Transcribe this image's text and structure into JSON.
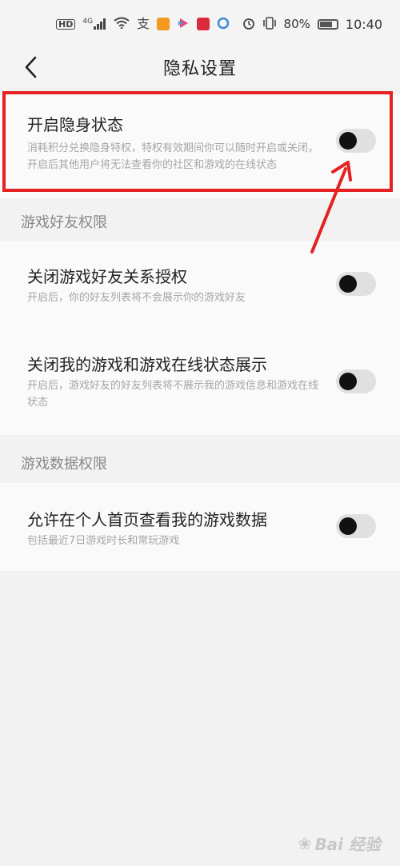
{
  "status_bar": {
    "network_labels": [
      "HD",
      "4G"
    ],
    "left_icon_names": [
      "hd-icon",
      "signal-icon",
      "wifi-icon",
      "alipay-icon",
      "app-icon-orange",
      "app-icon-bilibili",
      "app-icon-red",
      "app-icon-blue"
    ],
    "battery": "80%",
    "time": "10:40"
  },
  "header": {
    "title": "隐私设置"
  },
  "invisible": {
    "title": "开启隐身状态",
    "desc": "消耗积分兑换隐身特权，特权有效期间你可以随时开启或关闭，开启后其他用户将无法查看你的社区和游戏的在线状态",
    "toggle_on": false
  },
  "friends_section": {
    "label": "游戏好友权限",
    "items": [
      {
        "title": "关闭游戏好友关系授权",
        "desc": "开启后，你的好友列表将不会展示你的游戏好友",
        "toggle_on": false
      },
      {
        "title": "关闭我的游戏和游戏在线状态展示",
        "desc": "开启后，游戏好友的好友列表将不展示我的游戏信息和游戏在线状态",
        "toggle_on": false
      }
    ]
  },
  "data_section": {
    "label": "游戏数据权限",
    "items": [
      {
        "title": "允许在个人首页查看我的游戏数据",
        "desc": "包括最近7日游戏时长和常玩游戏",
        "toggle_on": false
      }
    ]
  },
  "watermark": {
    "text": "Bai 经验"
  },
  "colors": {
    "highlight": "#e52222",
    "toggle_track": "#e0e0e0",
    "toggle_knob": "#111111"
  }
}
